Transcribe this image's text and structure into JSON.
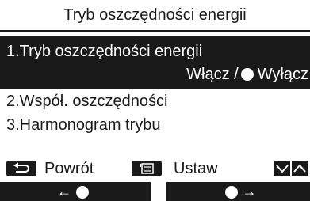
{
  "screen": {
    "title": "Tryb oszczędności energii"
  },
  "menu": {
    "items": [
      {
        "label": "1.Tryb oszczędności energii",
        "value_left": "Włącz /",
        "value_right": "Wyłącz",
        "selected": true
      },
      {
        "label": "2.Współ. oszczędności"
      },
      {
        "label": "3.Harmonogram trybu"
      }
    ]
  },
  "softkeys": {
    "back_label": "Powrót",
    "set_label": "Ustaw"
  },
  "function_buttons": {
    "left_arrow": "←",
    "right_arrow": "→"
  },
  "colors": {
    "foreground": "#1a1a1a",
    "background": "#ffffff"
  }
}
